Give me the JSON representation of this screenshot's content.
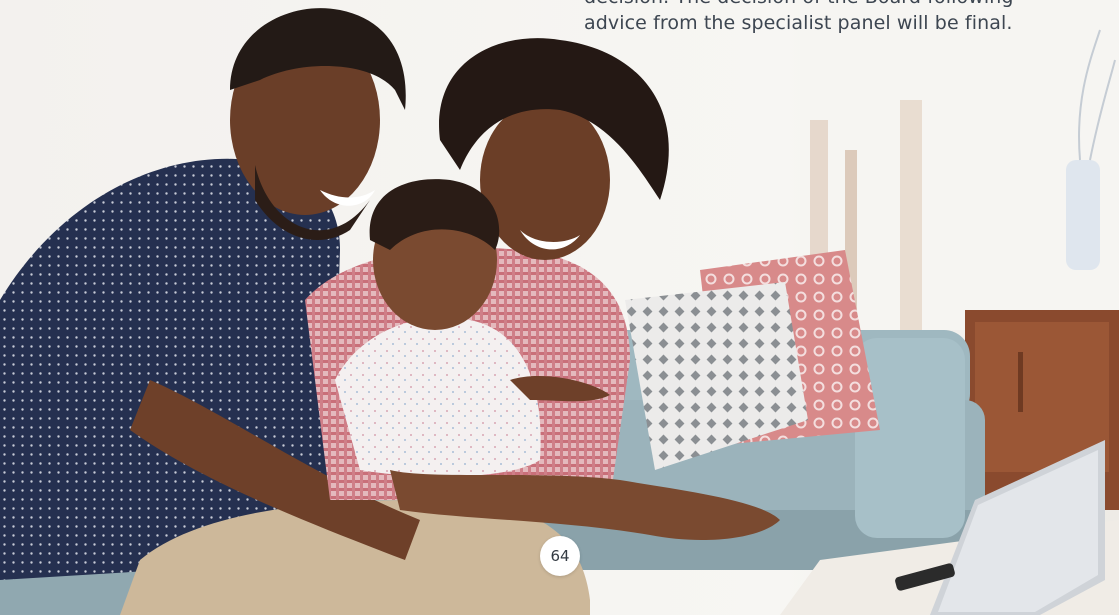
{
  "body_text": {
    "line_1": "decision. The decision of the Board following",
    "line_2": "advice from the specialist panel will be final."
  },
  "page_number": "64"
}
